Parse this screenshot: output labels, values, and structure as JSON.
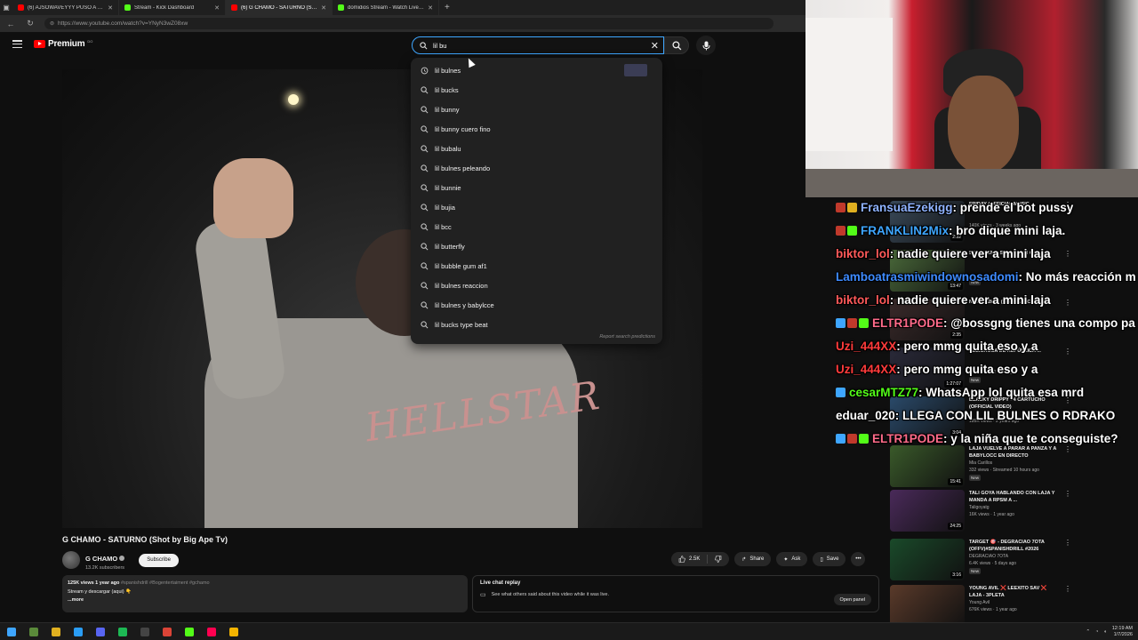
{
  "browser": {
    "tabs": [
      {
        "title": "(6) AJSOWAVEYYY PUSO A MINI LAJA",
        "color": "#ff0000",
        "active": false
      },
      {
        "title": "Stream - Kick Dashboard",
        "color": "#53fc18",
        "active": false
      },
      {
        "title": "(6) G CHAMO - SATURNO (Shot by Big Ape Tv)",
        "color": "#ff0000",
        "active": true
      },
      {
        "title": "domidios Stream - Watch Live on Kick",
        "color": "#53fc18",
        "active": false
      }
    ],
    "new_tab": "+",
    "url": "https://www.youtube.com/watch?v=YNyN3wZ08xw"
  },
  "header": {
    "logo_word": "Premium",
    "logo_cc": "DO",
    "search_query": "lil bu"
  },
  "suggestions": {
    "items": [
      {
        "text": "lil bulnes",
        "icon": "history-icon",
        "has_thumb": true
      },
      {
        "text": "lil bucks",
        "icon": "search-icon"
      },
      {
        "text": "lil bunny",
        "icon": "search-icon"
      },
      {
        "text": "lil bunny cuero fino",
        "icon": "search-icon"
      },
      {
        "text": "lil bubalu",
        "icon": "search-icon"
      },
      {
        "text": "lil bulnes peleando",
        "icon": "search-icon"
      },
      {
        "text": "lil bunnie",
        "icon": "search-icon"
      },
      {
        "text": "lil bujia",
        "icon": "search-icon"
      },
      {
        "text": "lil bcc",
        "icon": "search-icon"
      },
      {
        "text": "lil butterfly",
        "icon": "search-icon"
      },
      {
        "text": "lil bubble gum af1",
        "icon": "search-icon"
      },
      {
        "text": "lil bulnes reaccion",
        "icon": "search-icon"
      },
      {
        "text": "lil bulnes y babylcce",
        "icon": "search-icon"
      },
      {
        "text": "lil bucks type beat",
        "icon": "search-icon"
      }
    ],
    "report": "Report search predictions"
  },
  "video": {
    "title": "G CHAMO - SATURNO (Shot by Big Ape Tv)",
    "channel": "G CHAMO",
    "subscribers": "13.2K subscribers",
    "subscribe_label": "Subscribe",
    "likes": "2.5K",
    "share_label": "Share",
    "ask_label": "Ask",
    "save_label": "Save",
    "print_text": "HELLSTAR"
  },
  "description": {
    "meta": "125K views  1 year ago",
    "tags": "#spanishdrill #Bogentertaiment #gchamo",
    "line2": "Stream y descargar (aqui) 👇",
    "more": "...more"
  },
  "live_chat_replay": {
    "title": "Live chat replay",
    "subtitle": "See what others said about this video while it was live.",
    "open_panel": "Open panel"
  },
  "recommendations": [
    {
      "title": "FRIDAY (OFFICIAL MUSIC ...",
      "channel": "",
      "stats": "140K views · 3 weeks ago",
      "duration": "2:32",
      "badge": "",
      "color": "#3a4a5a"
    },
    {
      "title": "SE METEN A SU CASA IN GTA RP",
      "channel": "",
      "stats": "",
      "duration": "13:47",
      "badge": "New",
      "color": "#4a6a3a"
    },
    {
      "title": "NUEVO 2K26 (VIDEO OFICIAL)",
      "channel": "",
      "stats": "",
      "duration": "2:35",
      "badge": "",
      "color": "#3a2a2a"
    },
    {
      "title": "PELIGROSA de REPÚBLICA ...",
      "channel": "",
      "stats": "70K views · 2 days ago",
      "duration": "1:27:07",
      "badge": "New",
      "color": "#2a2a3a"
    },
    {
      "title": "Blacky Drippy - 4 Cartucho (Official Video)",
      "channel": "",
      "stats": "185K views · 2 years ago",
      "duration": "3:04",
      "badge": "",
      "color": "#2a4a6a"
    },
    {
      "title": "LAJA VUELVE A PARAR A PANZA Y A BABYLOCC EN DIRECTO",
      "channel": "Mia Carillos",
      "stats": "332 views · Streamed 10 hours ago",
      "duration": "15:41",
      "badge": "New",
      "color": "#3a5a2a"
    },
    {
      "title": "TALI GOYA HABLANDO CON LAJA Y MANDA A RPSM A ...",
      "channel": "Taligoyatg",
      "stats": "16K views · 1 year ago",
      "duration": "24:25",
      "badge": "",
      "color": "#4a2a5a"
    },
    {
      "title": "TARGET 🎯 - DEGRACIAO 7OTA (OFFV)#spanishdrill #2026",
      "channel": "DEGRACIAO 7OTA",
      "stats": "6.4K views · 5 days ago",
      "duration": "3:16",
      "badge": "New",
      "color": "#1a4a2a"
    },
    {
      "title": "Young Avil ❌ Leexito Sav ❌ Laja - 3PLETA",
      "channel": "Young Avil",
      "stats": "676K views · 1 year ago",
      "duration": "",
      "badge": "",
      "color": "#5a3a2a"
    }
  ],
  "chat": [
    {
      "user": "FransuaEzekigg",
      "color": "#8fb3ff",
      "msg": ": prende el bot pussy",
      "badges": [
        "#c0392b",
        "#e0b020"
      ]
    },
    {
      "user": "FRANKLIN2Mix",
      "color": "#3ea6ff",
      "msg": ": bro dique mini laja.",
      "badges": [
        "#c0392b",
        "#53fc18"
      ]
    },
    {
      "user": "biktor_lol",
      "color": "#ff5a5a",
      "msg": ": nadie quiere ver a mini laja",
      "badges": []
    },
    {
      "user": "Lamboatrasmiwindownosadomi",
      "color": "#3e8bff",
      "msg": ": No más reacción m",
      "badges": []
    },
    {
      "user": "biktor_lol",
      "color": "#ff5a5a",
      "msg": ": nadie quiere ver a mini laja",
      "badges": []
    },
    {
      "user": "ELTR1PODE",
      "color": "#ff6b8a",
      "msg": ": @bossgng tienes una compo pa",
      "badges": [
        "#3ea6ff",
        "#c0392b",
        "#53fc18"
      ]
    },
    {
      "user": "Uzi_444XX",
      "color": "#ff3b3b",
      "msg": ": pero mmg quita eso y a",
      "badges": []
    },
    {
      "user": "Uzi_444XX",
      "color": "#ff3b3b",
      "msg": ": pero mmg quita eso y a",
      "badges": []
    },
    {
      "user": "cesarMTZ77",
      "color": "#53fc18",
      "msg": ": WhatsApp lol quita esa mrd",
      "badges": [
        "#3ea6ff"
      ]
    },
    {
      "user": "eduar_020",
      "color": "#ffffff",
      "msg": ": LLEGA CON LIL BULNES O RDRAKO",
      "badges": []
    },
    {
      "user": "ELTR1PODE",
      "color": "#ff6b8a",
      "msg": ": y la niña que te conseguiste?",
      "badges": [
        "#3ea6ff",
        "#c0392b",
        "#53fc18"
      ]
    }
  ],
  "taskbar": {
    "icons": [
      {
        "name": "windows-start-icon",
        "color": "#3ea6ff"
      },
      {
        "name": "minecraft-icon",
        "color": "#5a8a3a"
      },
      {
        "name": "file-explorer-icon",
        "color": "#e0b020"
      },
      {
        "name": "edge-icon",
        "color": "#2a9df4"
      },
      {
        "name": "discord-icon",
        "color": "#5865f2"
      },
      {
        "name": "spotify-icon",
        "color": "#1db954"
      },
      {
        "name": "obs-icon",
        "color": "#444444"
      },
      {
        "name": "chrome-icon",
        "color": "#db4437"
      },
      {
        "name": "kick-icon",
        "color": "#53fc18"
      },
      {
        "name": "tiktok-icon",
        "color": "#ff0050"
      },
      {
        "name": "chrome-profile-icon",
        "color": "#f4b400"
      }
    ],
    "time": "12:19 AM",
    "date": "1/7/2026"
  }
}
